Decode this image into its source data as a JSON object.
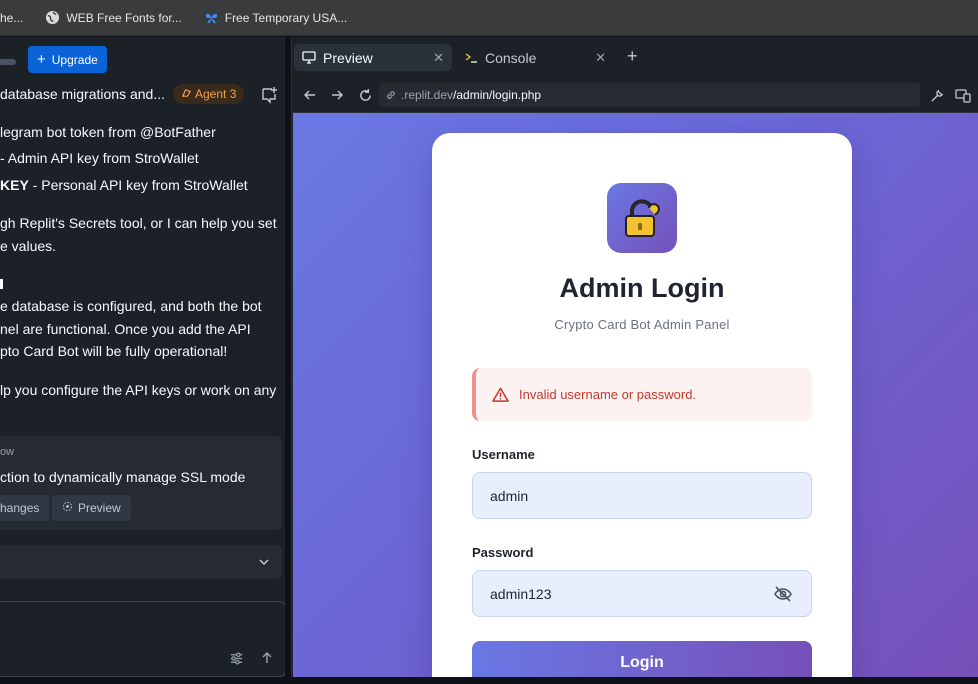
{
  "bookmarks": [
    {
      "label": "he...",
      "icon": "page-icon"
    },
    {
      "label": "WEB Free Fonts for...",
      "icon": "globe-icon"
    },
    {
      "label": "Free Temporary USA...",
      "icon": "butterfly-icon"
    }
  ],
  "left": {
    "upgrade_label": "Upgrade",
    "thread_title": "database migrations and...",
    "agent_badge": "Agent 3",
    "lines": [
      {
        "text": "legram bot token from @BotFather"
      },
      {
        "text": " - Admin API key from StroWallet"
      },
      {
        "bold": "KEY",
        "text": " - Personal API key from StroWallet"
      },
      {
        "text": "gh Replit's Secrets tool, or I can help you set"
      },
      {
        "text": "e values."
      },
      {
        "text": "e database is configured, and both the bot"
      },
      {
        "text": "nel are functional. Once you add the API"
      },
      {
        "text": "pto Card Bot will be fully operational!"
      },
      {
        "text": "lp you configure the API keys or work on any"
      }
    ],
    "card_label": "ow",
    "card_desc": "ction to dynamically manage SSL mode",
    "chip_changes": "hanges",
    "chip_preview": "Preview"
  },
  "tabs": {
    "preview": "Preview",
    "console": "Console"
  },
  "url": {
    "domain": ".replit.dev",
    "path": "/admin/login.php"
  },
  "login": {
    "title": "Admin Login",
    "subtitle": "Crypto Card Bot Admin Panel",
    "error": "Invalid username or password.",
    "username_label": "Username",
    "username_value": "admin",
    "password_label": "Password",
    "password_value": "admin123",
    "button": "Login"
  },
  "colors": {
    "accent": "#0b63d8",
    "gradient_start": "#6a78e4",
    "gradient_end": "#7650b8",
    "error": "#c0392b"
  }
}
